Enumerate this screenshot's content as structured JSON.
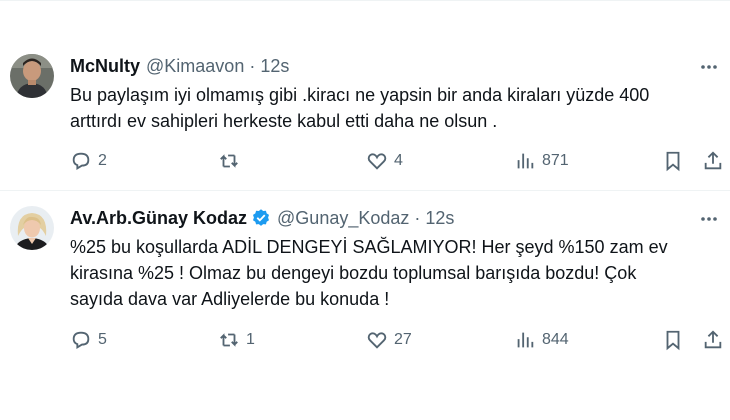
{
  "tweets": [
    {
      "name": "McNulty",
      "handle": "@Kimaavon",
      "sep": "·",
      "time": "12s",
      "verified": false,
      "lines": [
        "Bu paylaşım iyi olmamış gibi .kiracı ne yapsin bir anda kiraları yüzde 400",
        "arttırdı ev sahipleri herkeste kabul etti daha ne olsun ."
      ],
      "replies": "2",
      "retweets": "",
      "likes": "4",
      "views": "871"
    },
    {
      "name": "Av.Arb.Günay Kodaz",
      "handle": "@Gunay_Kodaz",
      "sep": "·",
      "time": "12s",
      "verified": true,
      "lines": [
        "%25 bu koşullarda ADİL DENGEYİ SAĞLAMIYOR! Her şeyd %150 zam ev",
        "kirasına %25 ! Olmaz bu dengeyi bozdu toplumsal barışıda bozdu! Çok",
        "sayıda dava var Adliyelerde bu konuda !"
      ],
      "replies": "5",
      "retweets": "1",
      "likes": "27",
      "views": "844"
    }
  ],
  "colors": {
    "text": "#0f1419",
    "muted": "#536471",
    "verified": "#1d9bf0",
    "separator": "#eff3f4"
  },
  "icons": [
    "reply-icon",
    "retweet-icon",
    "like-icon",
    "views-icon",
    "bookmark-icon",
    "share-icon",
    "more-icon",
    "verified-badge-icon"
  ]
}
